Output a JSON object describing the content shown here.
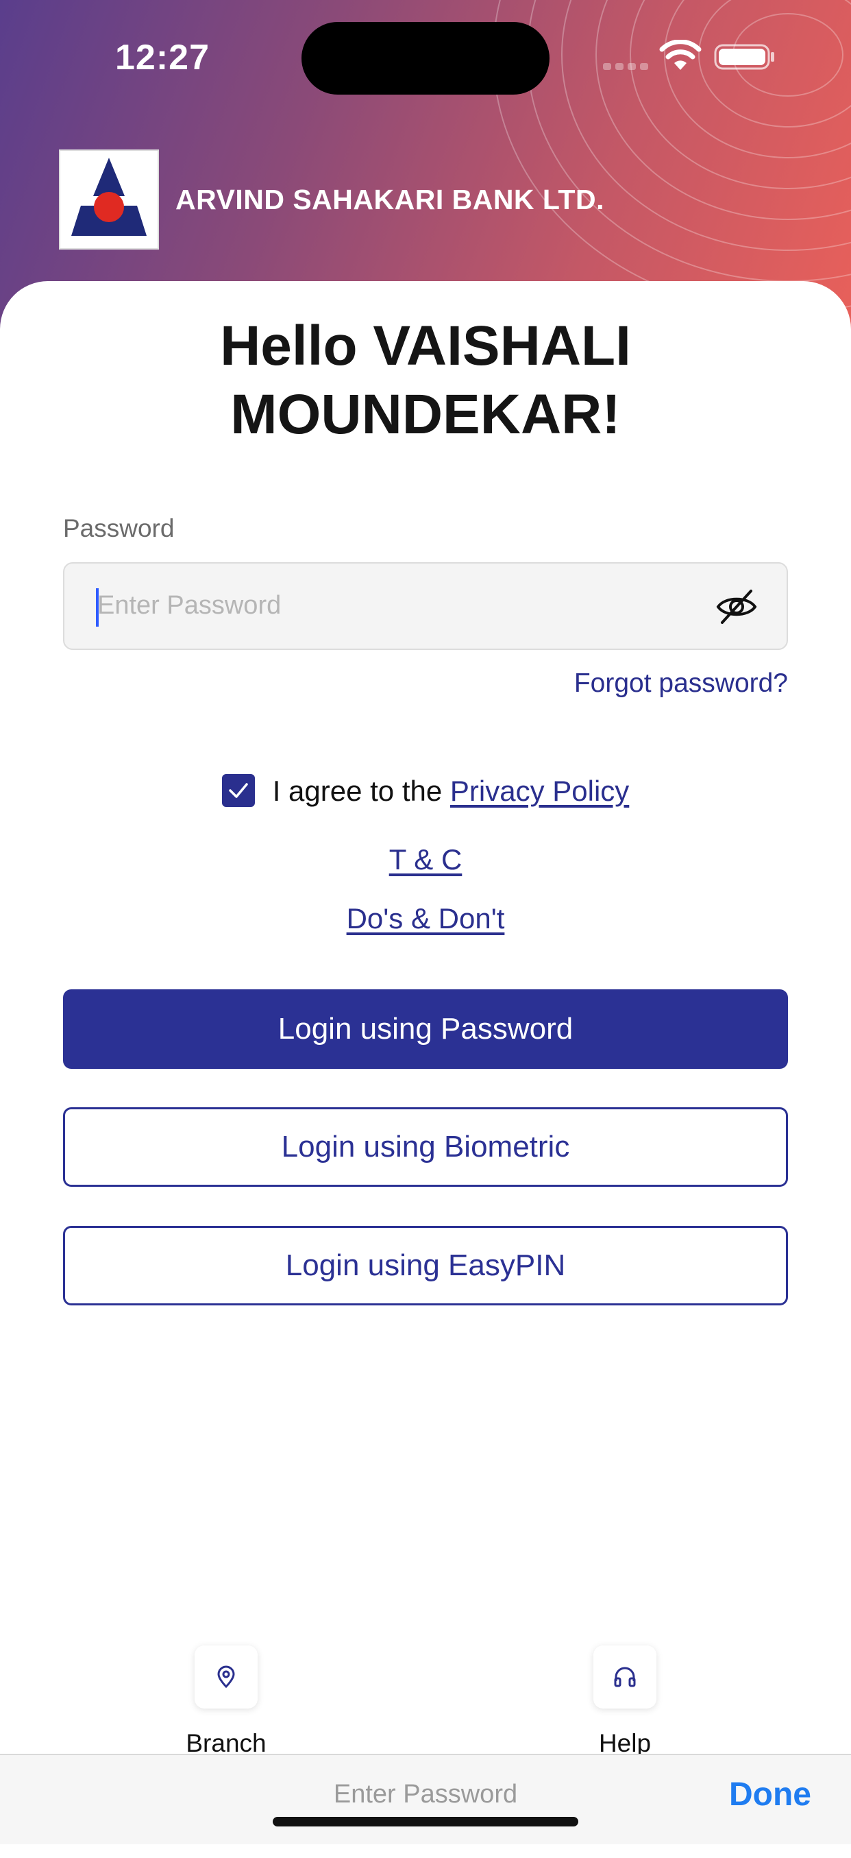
{
  "status_bar": {
    "time": "12:27"
  },
  "header": {
    "bank_name": "ARVIND SAHAKARI BANK LTD."
  },
  "greeting": {
    "line1": "Hello VAISHALI",
    "line2": "MOUNDEKAR!"
  },
  "password": {
    "label": "Password",
    "placeholder": "Enter Password",
    "value": "",
    "forgot_label": "Forgot password?"
  },
  "agreement": {
    "checked": true,
    "text": "I agree to the ",
    "privacy_link": "Privacy Policy",
    "tc_link": "T & C",
    "dos_link": "Do's & Don't"
  },
  "buttons": {
    "password_login": "Login using Password",
    "biometric_login": "Login using Biometric",
    "easypin_login": "Login using EasyPIN"
  },
  "bottom_nav": {
    "branch": {
      "label": "Branch",
      "icon": "location-pin-icon"
    },
    "help": {
      "label": "Help",
      "icon": "headphones-icon"
    }
  },
  "keyboard_bar": {
    "placeholder": "Enter Password",
    "done_label": "Done"
  },
  "colors": {
    "primary": "#2b3194",
    "link": "#2a2f8e",
    "done": "#1f7cf0",
    "gradient_start": "#5a3e8c",
    "gradient_end": "#e8605a"
  }
}
